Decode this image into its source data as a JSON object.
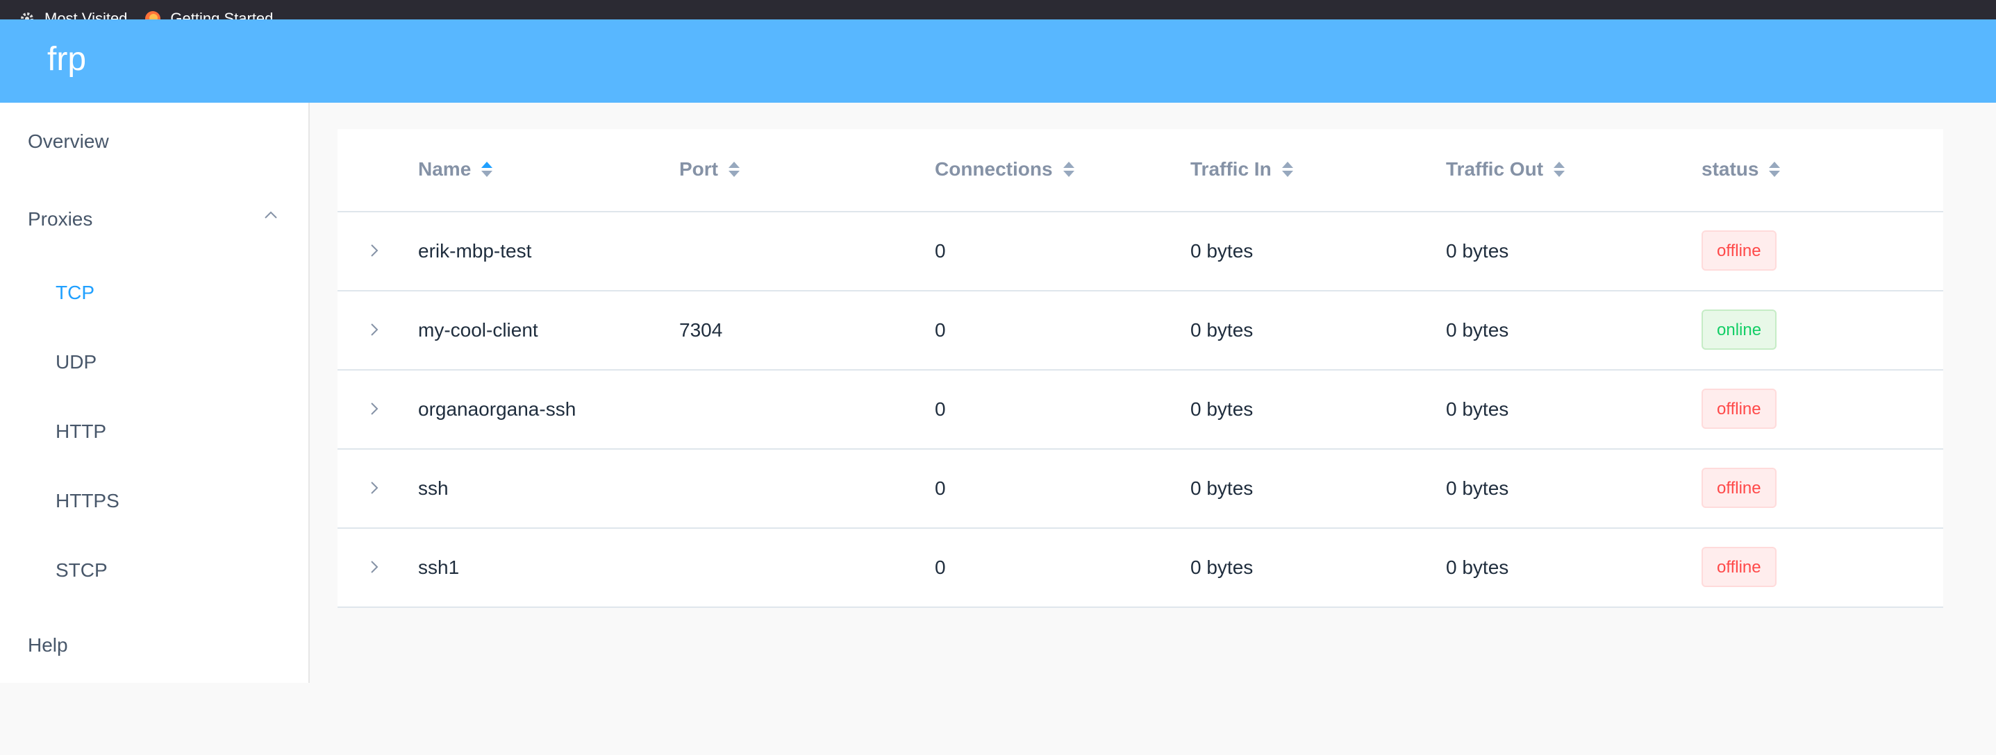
{
  "bookmarks": [
    {
      "label": "Most Visited",
      "icon": "gear-icon"
    },
    {
      "label": "Getting Started",
      "icon": "firefox-icon"
    }
  ],
  "app": {
    "title": "frp"
  },
  "sidebar": {
    "overview": "Overview",
    "proxies": "Proxies",
    "sub_items": [
      "TCP",
      "UDP",
      "HTTP",
      "HTTPS",
      "STCP"
    ],
    "active": "TCP",
    "help": "Help"
  },
  "table": {
    "columns": [
      "Name",
      "Port",
      "Connections",
      "Traffic In",
      "Traffic Out",
      "status"
    ],
    "sorted_column": "Name",
    "rows": [
      {
        "name": "erik-mbp-test",
        "port": "",
        "connections": "0",
        "traffic_in": "0 bytes",
        "traffic_out": "0 bytes",
        "status": "offline"
      },
      {
        "name": "my-cool-client",
        "port": "7304",
        "connections": "0",
        "traffic_in": "0 bytes",
        "traffic_out": "0 bytes",
        "status": "online"
      },
      {
        "name": "organaorgana-ssh",
        "port": "",
        "connections": "0",
        "traffic_in": "0 bytes",
        "traffic_out": "0 bytes",
        "status": "offline"
      },
      {
        "name": "ssh",
        "port": "",
        "connections": "0",
        "traffic_in": "0 bytes",
        "traffic_out": "0 bytes",
        "status": "offline"
      },
      {
        "name": "ssh1",
        "port": "",
        "connections": "0",
        "traffic_in": "0 bytes",
        "traffic_out": "0 bytes",
        "status": "offline"
      }
    ]
  },
  "colors": {
    "header": "#58b7ff",
    "active": "#20a0ff",
    "offline": "#ff4949",
    "online": "#13ce66"
  }
}
